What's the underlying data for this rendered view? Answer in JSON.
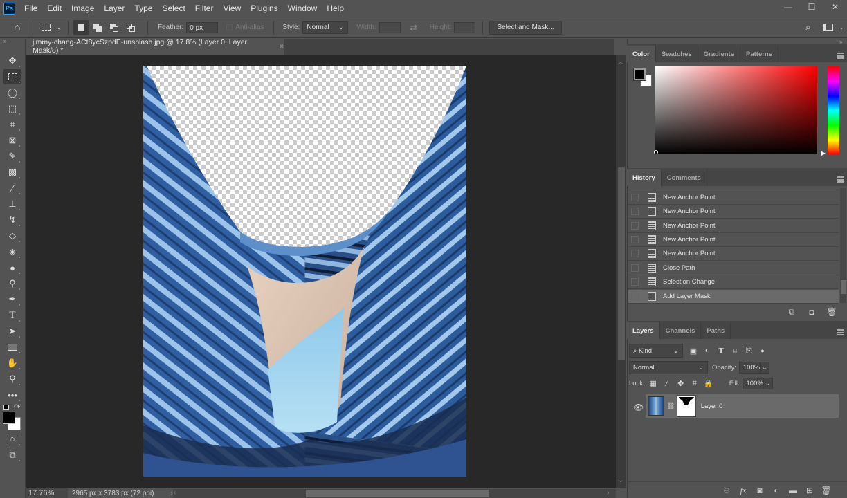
{
  "app": {
    "logo": "Ps"
  },
  "menu": [
    "File",
    "Edit",
    "Image",
    "Layer",
    "Type",
    "Select",
    "Filter",
    "View",
    "Plugins",
    "Window",
    "Help"
  ],
  "window_controls": {
    "minimize": "—",
    "maximize": "☐",
    "close": "✕"
  },
  "options": {
    "feather_label": "Feather:",
    "feather_value": "0 px",
    "antialias_label": "Anti-alias",
    "style_label": "Style:",
    "style_value": "Normal",
    "width_label": "Width:",
    "height_label": "Height:",
    "select_mask_label": "Select and Mask..."
  },
  "document": {
    "tab_title": "jimmy-chang-ACt8ycSzpdE-unsplash.jpg @ 17.8% (Layer 0, Layer Mask/8) *",
    "close": "×"
  },
  "status": {
    "zoom": "17.76%",
    "info": "2965 px x 3783 px (72 ppi)",
    "arrow": "›"
  },
  "color_panel": {
    "tabs": [
      "Color",
      "Swatches",
      "Gradients",
      "Patterns"
    ],
    "active_tab": "Color",
    "foreground": "#000000",
    "background": "#ffffff",
    "hue": "#ff0000"
  },
  "history_panel": {
    "tabs": [
      "History",
      "Comments"
    ],
    "items": [
      "New Anchor Point",
      "New Anchor Point",
      "New Anchor Point",
      "New Anchor Point",
      "New Anchor Point",
      "Close Path",
      "Selection Change",
      "Add Layer Mask"
    ],
    "active_index": 7
  },
  "layers_panel": {
    "tabs": [
      "Layers",
      "Channels",
      "Paths"
    ],
    "filter_value": "Kind",
    "blend_mode": "Normal",
    "opacity_label": "Opacity:",
    "opacity_value": "100%",
    "lock_label": "Lock:",
    "fill_label": "Fill:",
    "fill_value": "100%",
    "layers": [
      {
        "name": "Layer 0",
        "visible": true,
        "has_mask": true
      }
    ]
  }
}
